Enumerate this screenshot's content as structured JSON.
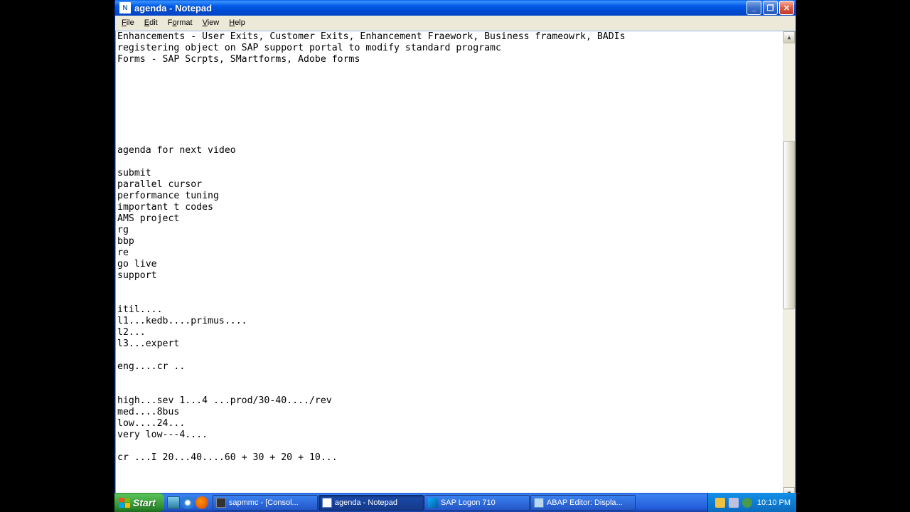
{
  "window": {
    "title": "agenda - Notepad",
    "app_icon_letter": "N"
  },
  "menubar": {
    "file": "File",
    "edit": "Edit",
    "format": "Format",
    "view": "View",
    "help": "Help"
  },
  "document_text": "Enhancements - User Exits, Customer Exits, Enhancement Fraework, Business frameowrk, BADIs\nregistering object on SAP support portal to modify standard programc\nForms - SAP Scrpts, SMartforms, Adobe forms\n\n\n\n\n\n\n\nagenda for next video\n\nsubmit\nparallel cursor\nperformance tuning\nimportant t codes\nAMS project\nrg\nbbp\nre\ngo live\nsupport\n\n\nitil....\nl1...kedb....primus....\nl2...\nl3...expert\n\neng....cr ..\n\n\nhigh...sev 1...4 ...prod/30-40..../rev\nmed....8bus\nlow....24...\nvery low---4....\n\ncr ...I 20...40....60 + 30 + 20 + 10...",
  "taskbar": {
    "start": "Start",
    "buttons": [
      {
        "label": "sapmmc - [Consol...",
        "icon": "console",
        "active": false
      },
      {
        "label": "agenda - Notepad",
        "icon": "notepad",
        "active": true
      },
      {
        "label": "SAP Logon 710",
        "icon": "sap",
        "active": false
      },
      {
        "label": "ABAP Editor: Displa...",
        "icon": "abap",
        "active": false
      }
    ],
    "clock": "10:10 PM"
  },
  "win_buttons": {
    "min": "_",
    "max": "❐",
    "close": "✕"
  },
  "scroll_arrows": {
    "up": "▲",
    "down": "▼",
    "left": "◀",
    "right": "▶"
  }
}
